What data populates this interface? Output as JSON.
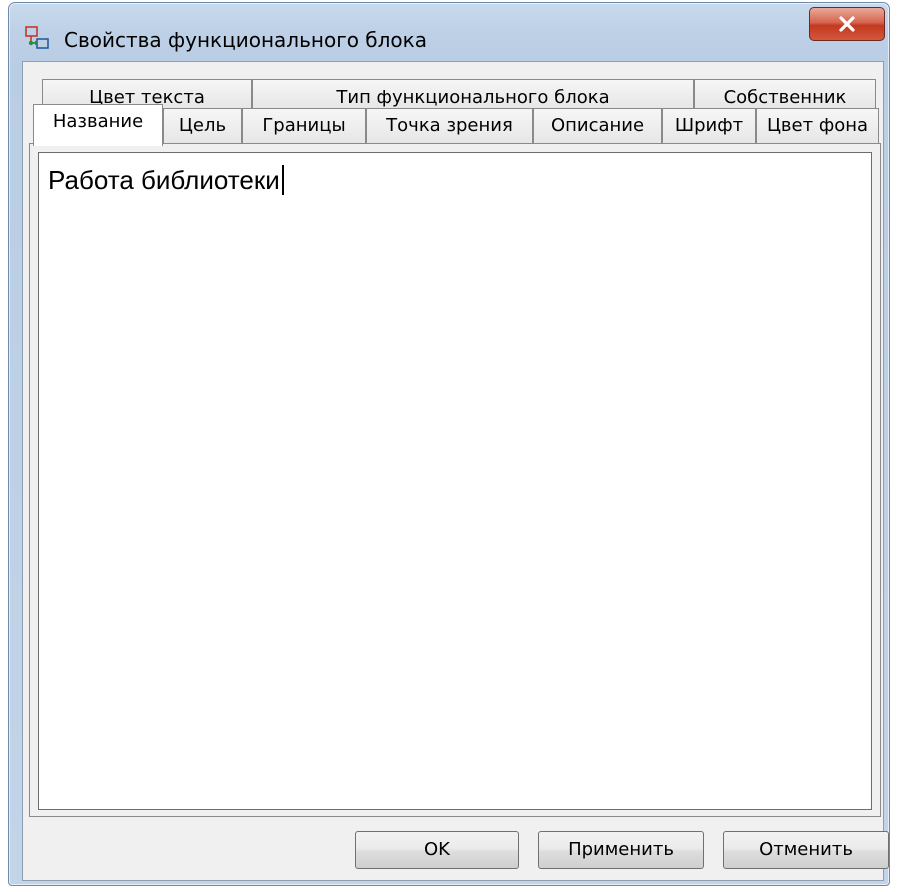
{
  "window": {
    "title": "Свойства функционального блока",
    "close_glyph": "x",
    "icon": "function-block-icon"
  },
  "tabs": {
    "row1": [
      {
        "label": "Цвет текста"
      },
      {
        "label": "Тип функционального блока"
      },
      {
        "label": "Собственник"
      }
    ],
    "row2": [
      {
        "label": "Название",
        "active": true
      },
      {
        "label": "Цель"
      },
      {
        "label": "Границы"
      },
      {
        "label": "Точка зрения"
      },
      {
        "label": "Описание"
      },
      {
        "label": "Шрифт"
      },
      {
        "label": "Цвет фона"
      }
    ]
  },
  "editor": {
    "value": "Работа библиотеки"
  },
  "buttons": {
    "ok": "OK",
    "apply": "Применить",
    "cancel": "Отменить"
  },
  "colors": {
    "close_button": "#c4391f",
    "title_bar": "#bdd0e6",
    "dialog_bg": "#f0f0f0"
  }
}
